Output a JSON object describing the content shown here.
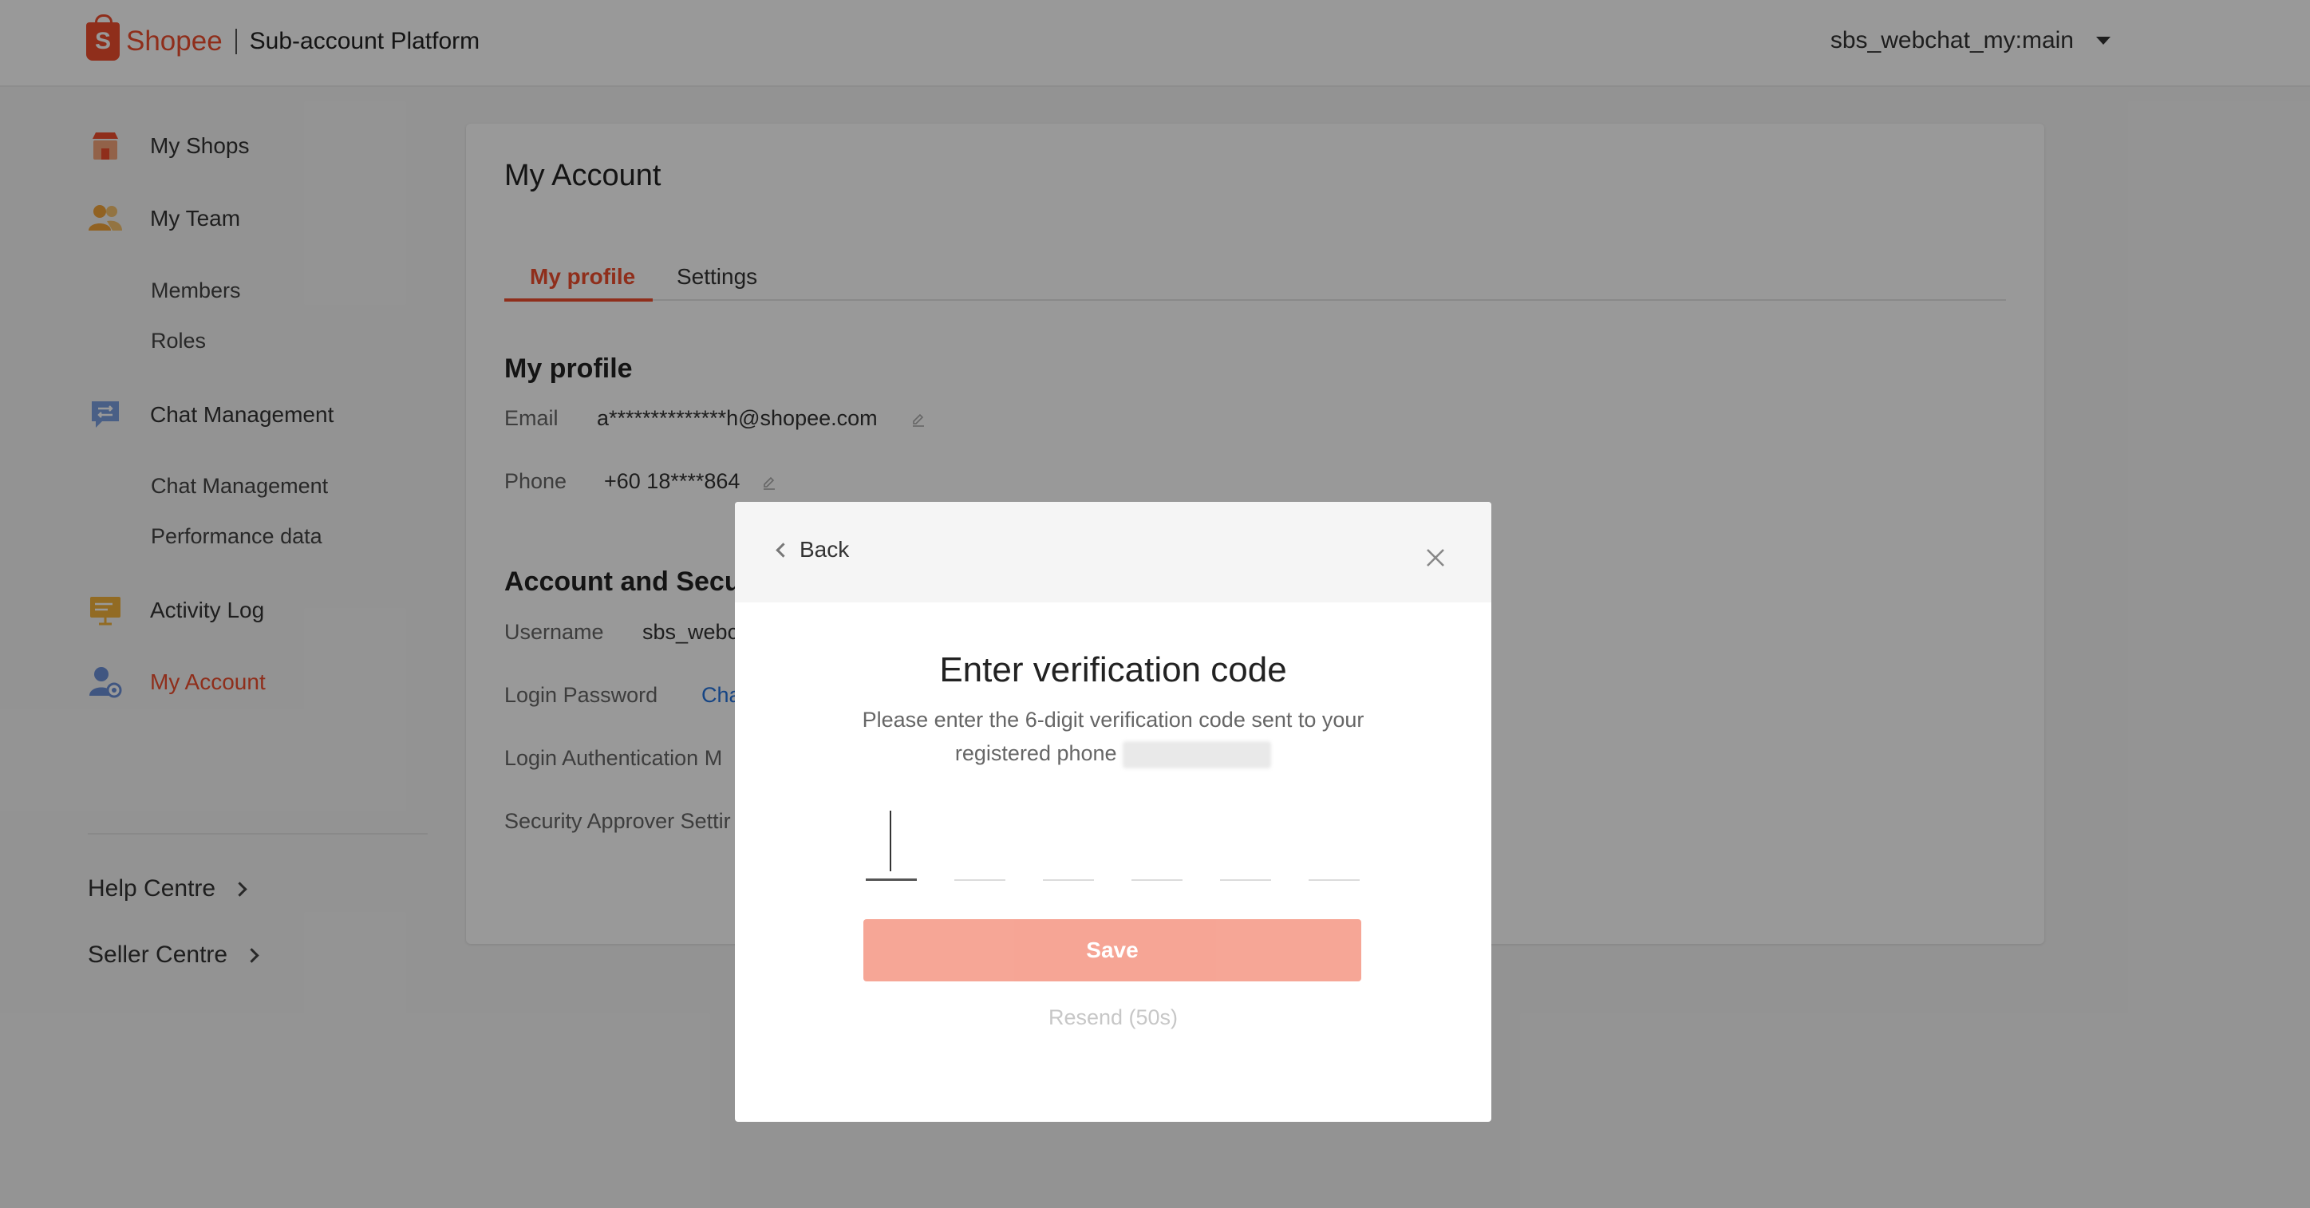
{
  "header": {
    "brand": "Shopee",
    "brand_glyph": "S",
    "platform": "Sub-account Platform",
    "user": "sbs_webchat_my:main"
  },
  "sidebar": {
    "items": [
      {
        "label": "My Shops",
        "icon": "shop-icon"
      },
      {
        "label": "My Team",
        "icon": "team-icon"
      },
      {
        "label": "Members"
      },
      {
        "label": "Roles"
      },
      {
        "label": "Chat Management",
        "icon": "chat-icon"
      },
      {
        "label": "Chat Management"
      },
      {
        "label": "Performance data"
      },
      {
        "label": "Activity Log",
        "icon": "activity-log-icon"
      },
      {
        "label": "My Account",
        "icon": "account-icon",
        "active": true
      }
    ],
    "links": [
      {
        "label": "Help Centre"
      },
      {
        "label": "Seller Centre"
      }
    ]
  },
  "main": {
    "title": "My Account",
    "tabs": [
      {
        "label": "My profile",
        "active": true
      },
      {
        "label": "Settings"
      }
    ],
    "profile": {
      "section_title": "My profile",
      "email_label": "Email",
      "email_value": "a**************h@shopee.com",
      "phone_label": "Phone",
      "phone_value": "+60 18****864"
    },
    "security": {
      "section_title": "Account and Secu",
      "username_label": "Username",
      "username_value": "sbs_webc",
      "password_label": "Login Password",
      "password_action": "Cha",
      "auth_label": "Login Authentication M",
      "approver_label": "Security Approver Settir"
    }
  },
  "modal": {
    "back_label": "Back",
    "title": "Enter verification code",
    "description": "Please enter the 6-digit verification code sent to your registered phone",
    "save_label": "Save",
    "resend_label": "Resend (50s)",
    "code_digits": [
      "",
      "",
      "",
      "",
      "",
      ""
    ]
  },
  "colors": {
    "accent": "#ee4d2d",
    "link": "#2673dd",
    "overlay": "rgba(0,0,0,0.4)"
  }
}
